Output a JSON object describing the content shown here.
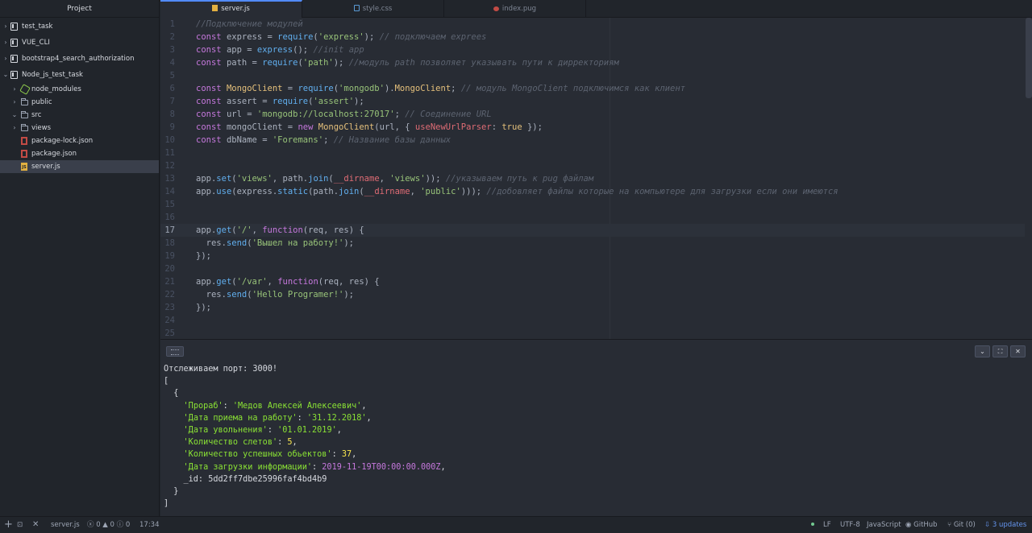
{
  "sidebar": {
    "title": "Project",
    "items": [
      {
        "label": "test_task"
      },
      {
        "label": "VUE_CLI"
      },
      {
        "label": "bootstrap4_search_authorization"
      },
      {
        "label": "Node_js_test_task"
      },
      {
        "label": "node_modules"
      },
      {
        "label": "public"
      },
      {
        "label": "src"
      },
      {
        "label": "views"
      },
      {
        "label": "package-lock.json"
      },
      {
        "label": "package.json"
      },
      {
        "label": "server.js"
      }
    ]
  },
  "tabs": [
    {
      "label": "server.js",
      "icon": "js-file-icon"
    },
    {
      "label": "style.css",
      "icon": "css-file-icon"
    },
    {
      "label": "index.pug",
      "icon": "pug-file-icon"
    }
  ],
  "editor": {
    "current_line": 17,
    "line_numbers": [
      "1",
      "2",
      "3",
      "4",
      "5",
      "6",
      "7",
      "8",
      "9",
      "10",
      "11",
      "12",
      "13",
      "14",
      "15",
      "16",
      "17",
      "18",
      "19",
      "20",
      "21",
      "22",
      "23",
      "24",
      "25"
    ],
    "lines": [
      [
        {
          "t": "c",
          "v": "//Подключение модулей"
        }
      ],
      [
        {
          "t": "k",
          "v": "const "
        },
        {
          "t": "p",
          "v": "express = "
        },
        {
          "t": "f",
          "v": "require"
        },
        {
          "t": "p",
          "v": "("
        },
        {
          "t": "s",
          "v": "'express'"
        },
        {
          "t": "p",
          "v": "); "
        },
        {
          "t": "c",
          "v": "// подключаем exprees"
        }
      ],
      [
        {
          "t": "k",
          "v": "const "
        },
        {
          "t": "p",
          "v": "app = "
        },
        {
          "t": "f",
          "v": "express"
        },
        {
          "t": "p",
          "v": "(); "
        },
        {
          "t": "c",
          "v": "//init app"
        }
      ],
      [
        {
          "t": "k",
          "v": "const "
        },
        {
          "t": "p",
          "v": "path = "
        },
        {
          "t": "f",
          "v": "require"
        },
        {
          "t": "p",
          "v": "("
        },
        {
          "t": "s",
          "v": "'path'"
        },
        {
          "t": "p",
          "v": "); "
        },
        {
          "t": "c",
          "v": "//модуль path позволяет указывать пути к дирректориям"
        }
      ],
      [],
      [
        {
          "t": "k",
          "v": "const "
        },
        {
          "t": "y",
          "v": "MongoClient"
        },
        {
          "t": "p",
          "v": " = "
        },
        {
          "t": "f",
          "v": "require"
        },
        {
          "t": "p",
          "v": "("
        },
        {
          "t": "s",
          "v": "'mongodb'"
        },
        {
          "t": "p",
          "v": ")."
        },
        {
          "t": "y",
          "v": "MongoClient"
        },
        {
          "t": "p",
          "v": "; "
        },
        {
          "t": "c",
          "v": "// модуль MongoClient подключимся как клиент"
        }
      ],
      [
        {
          "t": "k",
          "v": "const "
        },
        {
          "t": "p",
          "v": "assert = "
        },
        {
          "t": "f",
          "v": "require"
        },
        {
          "t": "p",
          "v": "("
        },
        {
          "t": "s",
          "v": "'assert'"
        },
        {
          "t": "p",
          "v": ");"
        }
      ],
      [
        {
          "t": "k",
          "v": "const "
        },
        {
          "t": "p",
          "v": "url = "
        },
        {
          "t": "s",
          "v": "'mongodb://localhost:27017'"
        },
        {
          "t": "p",
          "v": "; "
        },
        {
          "t": "c",
          "v": "// Соединение URL"
        }
      ],
      [
        {
          "t": "k",
          "v": "const "
        },
        {
          "t": "p",
          "v": "mongoClient = "
        },
        {
          "t": "k",
          "v": "new "
        },
        {
          "t": "y",
          "v": "MongoClient"
        },
        {
          "t": "p",
          "v": "(url, { "
        },
        {
          "t": "r",
          "v": "useNewUrlParser"
        },
        {
          "t": "p",
          "v": ": "
        },
        {
          "t": "y",
          "v": "true"
        },
        {
          "t": "p",
          "v": " });"
        }
      ],
      [
        {
          "t": "k",
          "v": "const "
        },
        {
          "t": "p",
          "v": "dbName = "
        },
        {
          "t": "s",
          "v": "'Foremans'"
        },
        {
          "t": "p",
          "v": "; "
        },
        {
          "t": "c",
          "v": "// Название базы данных"
        }
      ],
      [],
      [],
      [
        {
          "t": "p",
          "v": "app."
        },
        {
          "t": "f",
          "v": "set"
        },
        {
          "t": "p",
          "v": "("
        },
        {
          "t": "s",
          "v": "'views'"
        },
        {
          "t": "p",
          "v": ", path."
        },
        {
          "t": "f",
          "v": "join"
        },
        {
          "t": "p",
          "v": "("
        },
        {
          "t": "r",
          "v": "__dirname"
        },
        {
          "t": "p",
          "v": ", "
        },
        {
          "t": "s",
          "v": "'views'"
        },
        {
          "t": "p",
          "v": ")); "
        },
        {
          "t": "c",
          "v": "//указываем путь к pug файлам"
        }
      ],
      [
        {
          "t": "p",
          "v": "app."
        },
        {
          "t": "f",
          "v": "use"
        },
        {
          "t": "p",
          "v": "(express."
        },
        {
          "t": "f",
          "v": "static"
        },
        {
          "t": "p",
          "v": "(path."
        },
        {
          "t": "f",
          "v": "join"
        },
        {
          "t": "p",
          "v": "("
        },
        {
          "t": "r",
          "v": "__dirname"
        },
        {
          "t": "p",
          "v": ", "
        },
        {
          "t": "s",
          "v": "'public'"
        },
        {
          "t": "p",
          "v": "))); "
        },
        {
          "t": "c",
          "v": "//добовляет файлы которые на компьютере для загрузки если они имеются"
        }
      ],
      [],
      [],
      [
        {
          "t": "p",
          "v": "app."
        },
        {
          "t": "f",
          "v": "get"
        },
        {
          "t": "p",
          "v": "("
        },
        {
          "t": "s",
          "v": "'/'"
        },
        {
          "t": "p",
          "v": ", "
        },
        {
          "t": "k",
          "v": "function"
        },
        {
          "t": "p",
          "v": "(req, res) {"
        }
      ],
      [
        {
          "t": "p",
          "v": "  res."
        },
        {
          "t": "f",
          "v": "send"
        },
        {
          "t": "p",
          "v": "("
        },
        {
          "t": "s",
          "v": "'Вышел на работу!'"
        },
        {
          "t": "p",
          "v": ");"
        }
      ],
      [
        {
          "t": "p",
          "v": "});"
        }
      ],
      [],
      [
        {
          "t": "p",
          "v": "app."
        },
        {
          "t": "f",
          "v": "get"
        },
        {
          "t": "p",
          "v": "("
        },
        {
          "t": "s",
          "v": "'/var'"
        },
        {
          "t": "p",
          "v": ", "
        },
        {
          "t": "k",
          "v": "function"
        },
        {
          "t": "p",
          "v": "(req, res) {"
        }
      ],
      [
        {
          "t": "p",
          "v": "  res."
        },
        {
          "t": "f",
          "v": "send"
        },
        {
          "t": "p",
          "v": "("
        },
        {
          "t": "s",
          "v": "'Hello Programer!'"
        },
        {
          "t": "p",
          "v": ");"
        }
      ],
      [
        {
          "t": "p",
          "v": "});"
        }
      ],
      [],
      []
    ]
  },
  "terminal": {
    "lines": [
      [
        {
          "t": "w",
          "v": "Отслеживаем порт: 3000!"
        }
      ],
      [
        {
          "t": "w",
          "v": "["
        }
      ],
      [
        {
          "t": "w",
          "v": "  {"
        }
      ],
      [
        {
          "t": "w",
          "v": "    "
        },
        {
          "t": "g",
          "v": "'Прораб'"
        },
        {
          "t": "w",
          "v": ": "
        },
        {
          "t": "g",
          "v": "'Медов Алексей Алексеевич'"
        },
        {
          "t": "w",
          "v": ","
        }
      ],
      [
        {
          "t": "w",
          "v": "    "
        },
        {
          "t": "g",
          "v": "'Дата приема на работу'"
        },
        {
          "t": "w",
          "v": ": "
        },
        {
          "t": "g",
          "v": "'31.12.2018'"
        },
        {
          "t": "w",
          "v": ","
        }
      ],
      [
        {
          "t": "w",
          "v": "    "
        },
        {
          "t": "g",
          "v": "'Дата увольнения'"
        },
        {
          "t": "w",
          "v": ": "
        },
        {
          "t": "g",
          "v": "'01.01.2019'"
        },
        {
          "t": "w",
          "v": ","
        }
      ],
      [
        {
          "t": "w",
          "v": "    "
        },
        {
          "t": "g",
          "v": "'Количество слетов'"
        },
        {
          "t": "w",
          "v": ": "
        },
        {
          "t": "n",
          "v": "5"
        },
        {
          "t": "w",
          "v": ","
        }
      ],
      [
        {
          "t": "w",
          "v": "    "
        },
        {
          "t": "g",
          "v": "'Количество успешных обьектов'"
        },
        {
          "t": "w",
          "v": ": "
        },
        {
          "t": "n",
          "v": "37"
        },
        {
          "t": "w",
          "v": ","
        }
      ],
      [
        {
          "t": "w",
          "v": "    "
        },
        {
          "t": "g",
          "v": "'Дата загрузки информации'"
        },
        {
          "t": "w",
          "v": ": "
        },
        {
          "t": "m",
          "v": "2019-11-19T00:00:00.000Z"
        },
        {
          "t": "w",
          "v": ","
        }
      ],
      [
        {
          "t": "w",
          "v": "    _id: 5dd2ff7dbe25996faf4bd4b9"
        }
      ],
      [
        {
          "t": "w",
          "v": "  }"
        }
      ],
      [
        {
          "t": "w",
          "v": "]"
        }
      ]
    ]
  },
  "statusbar": {
    "file": "server.js",
    "diagnostics": "ⓧ 0 ▲ 0 ⓘ 0",
    "cursor": "17:34",
    "line_ending": "LF",
    "encoding": "UTF-8",
    "grammar": "JavaScript",
    "github": "GitHub",
    "git": "Git (0)",
    "updates": "3 updates"
  },
  "colors": {
    "background": "#282c34",
    "accent": "#528bff",
    "string": "#98c379",
    "keyword": "#c678dd",
    "comment": "#5c6370",
    "terminal_green": "#8ae234",
    "terminal_yellow": "#fce94f"
  }
}
